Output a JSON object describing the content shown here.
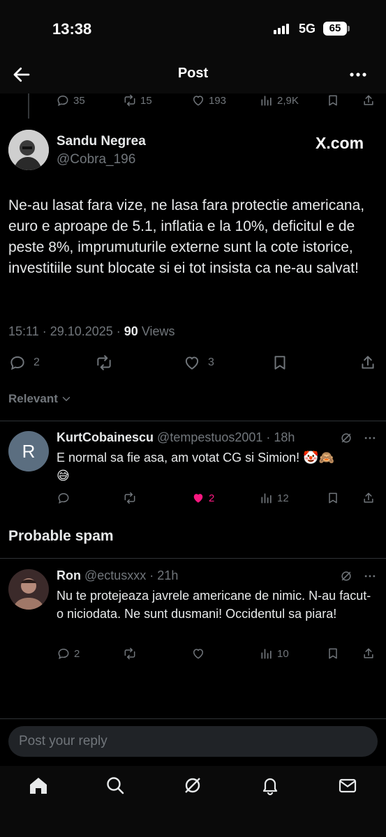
{
  "status_bar": {
    "time": "13:38",
    "network": "5G",
    "battery": "65"
  },
  "header": {
    "title": "Post"
  },
  "parent_actions": {
    "replies": "35",
    "reposts": "15",
    "likes": "193",
    "views": "2,9K"
  },
  "main_post": {
    "author_name": "Sandu Negrea",
    "author_handle": "@Cobra_196",
    "source": "X.com",
    "text": "Ne-au lasat fara vize, ne lasa fara protectie americana, euro e aproape de 5.1, inflatia e la 10%, deficitul e de peste 8%, imprumuturile externe sunt la cote istorice, investitiile sunt blocate si ei tot insista ca ne-au salvat!",
    "time_date": "15:11 · 29.10.2025 · ",
    "views_count": "90",
    "views_label": " Views",
    "replies": "2",
    "likes": "3"
  },
  "sort": {
    "label": "Relevant"
  },
  "reply1": {
    "avatar_letter": "R",
    "name": "KurtCobainescu",
    "handle_time": "@tempestuos2001 · 18h",
    "text": "E normal sa fie asa, am votat CG si Simion! 🤡🙈 😅",
    "likes": "2",
    "views": "12"
  },
  "spam_heading": "Probable spam",
  "reply2": {
    "name": "Ron",
    "handle_time": "@ectusxxx · 21h",
    "text": "Nu te protejeaza javrele americane de nimic. N-au facut-o niciodata. Ne sunt dusmani! Occidentul sa piara!",
    "replies": "2",
    "views": "10"
  },
  "composer": {
    "placeholder": "Post your reply"
  },
  "colors": {
    "like_active": "#f91880",
    "muted": "#71767b",
    "background": "#000000"
  }
}
